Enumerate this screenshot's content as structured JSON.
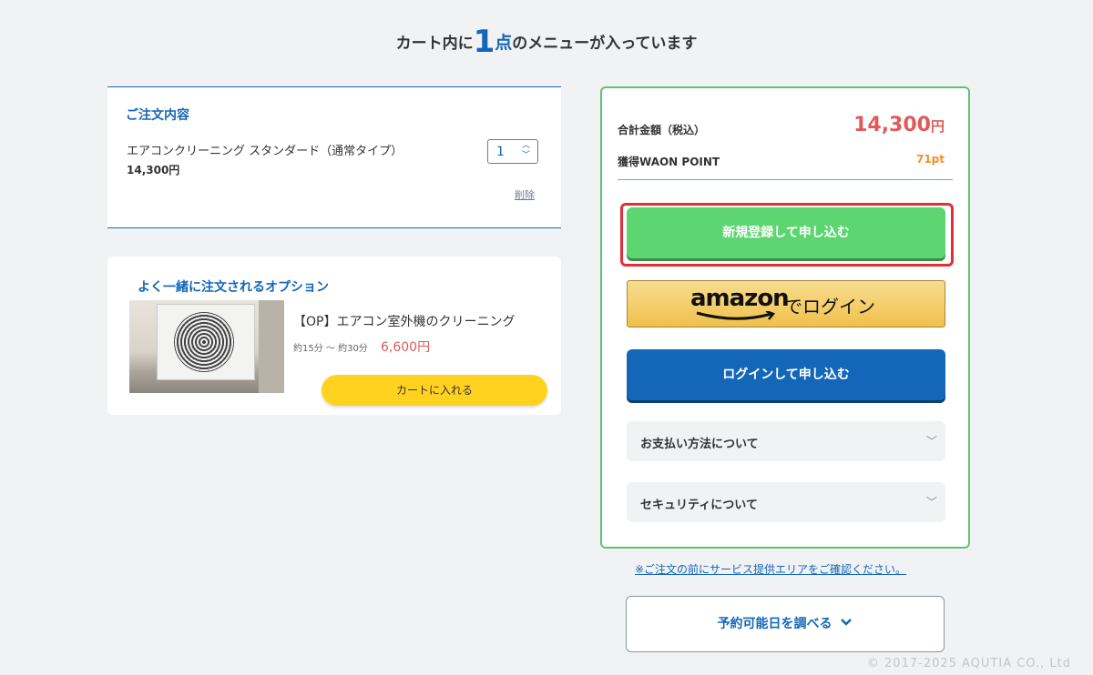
{
  "heading": {
    "prefix": "カート内に",
    "count": "1",
    "unit": "点",
    "suffix": "のメニューが入っています"
  },
  "order": {
    "title": "ご注文内容",
    "item_name": "エアコンクリーニング スタンダード（通常タイプ）",
    "item_price": "14,300円",
    "quantity": "1",
    "delete_label": "削除"
  },
  "option": {
    "title": "よく一緒に注文されるオプション",
    "name": "【OP】エアコン室外機のクリーニング",
    "time": "約15分 ～ 約30分",
    "price": "6,600円",
    "cart_button": "カートに入れる"
  },
  "summary": {
    "total_label": "合計金額（税込）",
    "total_value": "14,300",
    "total_unit": "円",
    "points_label": "獲得WAON POINT",
    "points_value": "71pt",
    "register_button": "新規登録して申し込む",
    "amazon_logo": "amazon",
    "amazon_suffix": "でログイン",
    "login_button": "ログインして申し込む",
    "payment_label": "お支払い方法について",
    "security_label": "セキュリティについて"
  },
  "area_notice": "※ご注文の前にサービス提供エリアをご確認ください。",
  "calendar_button": "予約可能日を調べる",
  "footer": "© 2017-2025 AQUTIA CO., Ltd",
  "colors": {
    "brand_blue": "#1466b8",
    "green": "#5dd672",
    "price_red": "#e05a5a",
    "highlight_red": "#e0303a",
    "cta_yellow": "#ffd21f"
  }
}
